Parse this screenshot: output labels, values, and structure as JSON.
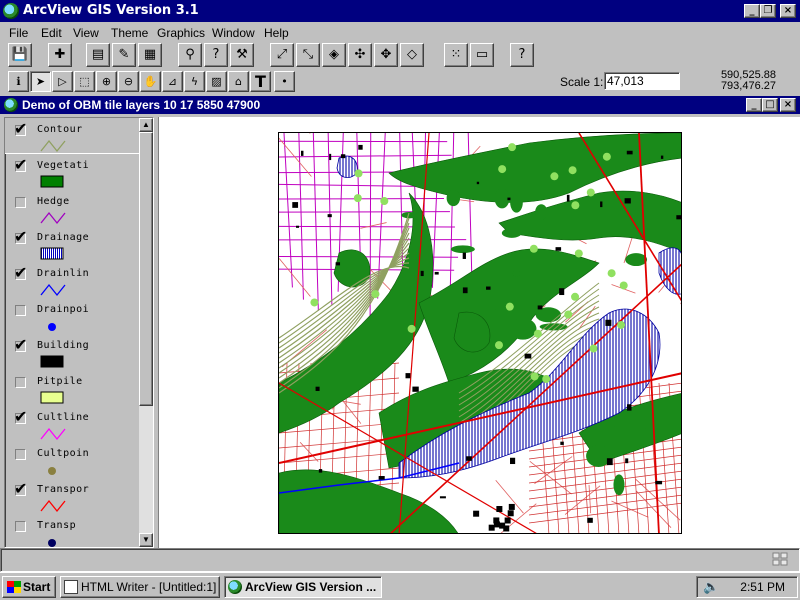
{
  "app": {
    "title": "ArcView GIS Version 3.1",
    "minimize": "_",
    "restore": "❐",
    "close": "×"
  },
  "menu": [
    "File",
    "Edit",
    "View",
    "Theme",
    "Graphics",
    "Window",
    "Help"
  ],
  "toolbar": {
    "scale_label": "Scale 1:",
    "scale_value": "47,013",
    "coord_x": "590,525.88",
    "coord_y": "793,476.27"
  },
  "document": {
    "title": "Demo of OBM tile layers 10 17 5850 47900"
  },
  "layers": [
    {
      "name": "Contour",
      "checked": true,
      "symbol": "line",
      "color": "#8fa060"
    },
    {
      "name": "Vegetati",
      "checked": true,
      "symbol": "fill",
      "color": "#008000"
    },
    {
      "name": "Hedge",
      "checked": false,
      "symbol": "line",
      "color": "#a000c0"
    },
    {
      "name": "Drainage",
      "checked": true,
      "symbol": "hatch",
      "color": "#0000c0"
    },
    {
      "name": "Drainlin",
      "checked": true,
      "symbol": "line",
      "color": "#0000ff"
    },
    {
      "name": "Drainpoi",
      "checked": false,
      "symbol": "point",
      "color": "#0000ff"
    },
    {
      "name": "Building",
      "checked": true,
      "symbol": "fill",
      "color": "#000000"
    },
    {
      "name": "Pitpile",
      "checked": false,
      "symbol": "fill",
      "color": "#e8ff90"
    },
    {
      "name": "Cultline",
      "checked": true,
      "symbol": "line",
      "color": "#ff00ff"
    },
    {
      "name": "Cultpoin",
      "checked": false,
      "symbol": "point",
      "color": "#8a8040"
    },
    {
      "name": "Transpor",
      "checked": true,
      "symbol": "line",
      "color": "#ff0000"
    },
    {
      "name": "Transp",
      "checked": false,
      "symbol": "point",
      "color": "#000060"
    }
  ],
  "taskbar": {
    "start": "Start",
    "tasks": [
      "HTML Writer - [Untitled:1]",
      "ArcView GIS Version ..."
    ],
    "clock": "2:51 PM"
  },
  "colors": {
    "titlebar": "#000080",
    "face": "#c0c0c0",
    "vegetation": "#1a8a1a",
    "contour": "#8fa060",
    "water": "#2020c0",
    "roads": "#e00000",
    "culture": "#c000c0"
  }
}
